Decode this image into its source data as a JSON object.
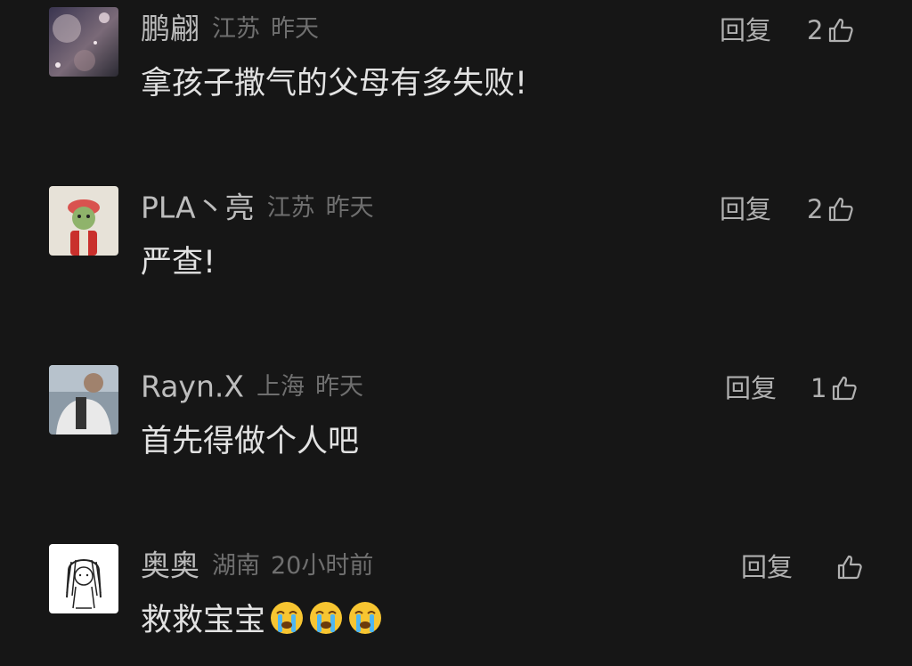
{
  "comments": [
    {
      "username": "鹏翩",
      "location": "江苏",
      "time": "昨天",
      "text": "拿孩子撒气的父母有多失败!",
      "reply_label": "回复",
      "likes": "2",
      "avatar_icon": "night-sky-avatar",
      "like_icon": "thumbs-up-icon"
    },
    {
      "username": "PLA丶亮",
      "location": "江苏",
      "time": "昨天",
      "text": "严查!",
      "reply_label": "回复",
      "likes": "2",
      "avatar_icon": "cartoon-character-avatar",
      "like_icon": "thumbs-up-icon"
    },
    {
      "username": "Rayn.X",
      "location": "上海",
      "time": "昨天",
      "text": "首先得做个人吧",
      "reply_label": "回复",
      "likes": "1",
      "avatar_icon": "person-photo-avatar",
      "like_icon": "thumbs-up-icon"
    },
    {
      "username": "奥奥",
      "location": "湖南",
      "time": "20小时前",
      "text": "救救宝宝",
      "reply_label": "回复",
      "likes": "",
      "avatar_icon": "sketch-girl-avatar",
      "like_icon": "thumbs-up-icon",
      "text_emojis": [
        "crying-face-emoji",
        "crying-face-emoji",
        "crying-face-emoji"
      ]
    }
  ],
  "colors": {
    "background": "#161616",
    "username": "#bdbdbd",
    "meta": "#6f6f6f",
    "text": "#e2e2e2",
    "action": "#b0b0b0"
  }
}
